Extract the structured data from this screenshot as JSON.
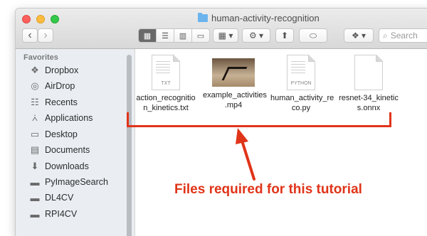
{
  "window": {
    "title": "human-activity-recognition"
  },
  "toolbar": {
    "back_glyph": "‹",
    "forward_glyph": "›",
    "view_modes": [
      {
        "name": "icon-view",
        "glyph": "▦",
        "active": true
      },
      {
        "name": "list-view",
        "glyph": "☰",
        "active": false
      },
      {
        "name": "column-view",
        "glyph": "▥",
        "active": false
      },
      {
        "name": "gallery-view",
        "glyph": "▭",
        "active": false
      }
    ],
    "group_glyph": "▦ ▾",
    "action_glyph": "⚙ ▾",
    "share_glyph": "⬆",
    "tag_glyph": "⬭",
    "dropbox_glyph": "❖ ▾",
    "search_placeholder": "Search"
  },
  "sidebar": {
    "section_title": "Favorites",
    "items": [
      {
        "label": "Dropbox",
        "icon": "dropbox-icon",
        "glyph": "❖"
      },
      {
        "label": "AirDrop",
        "icon": "airdrop-icon",
        "glyph": "◎"
      },
      {
        "label": "Recents",
        "icon": "recents-icon",
        "glyph": "☷"
      },
      {
        "label": "Applications",
        "icon": "applications-icon",
        "glyph": "⩑"
      },
      {
        "label": "Desktop",
        "icon": "desktop-icon",
        "glyph": "▭"
      },
      {
        "label": "Documents",
        "icon": "documents-icon",
        "glyph": "▤"
      },
      {
        "label": "Downloads",
        "icon": "downloads-icon",
        "glyph": "⬇"
      },
      {
        "label": "PyImageSearch",
        "icon": "folder-icon",
        "glyph": "▬"
      },
      {
        "label": "DL4CV",
        "icon": "folder-icon",
        "glyph": "▬"
      },
      {
        "label": "RPI4CV",
        "icon": "folder-icon",
        "glyph": "▬"
      }
    ]
  },
  "files": [
    {
      "name_line1": "action_recognitio",
      "name_line2": "n_kinetics.txt",
      "kind": "TXT"
    },
    {
      "name_line1": "example_activities",
      "name_line2": ".mp4",
      "kind": ""
    },
    {
      "name_line1": "human_activity_re",
      "name_line2": "co.py",
      "kind": "PYTHON"
    },
    {
      "name_line1": "resnet-34_kinetic",
      "name_line2": "s.onnx",
      "kind": ""
    }
  ],
  "annotation": {
    "caption": "Files required for this tutorial",
    "color": "#e03419"
  }
}
